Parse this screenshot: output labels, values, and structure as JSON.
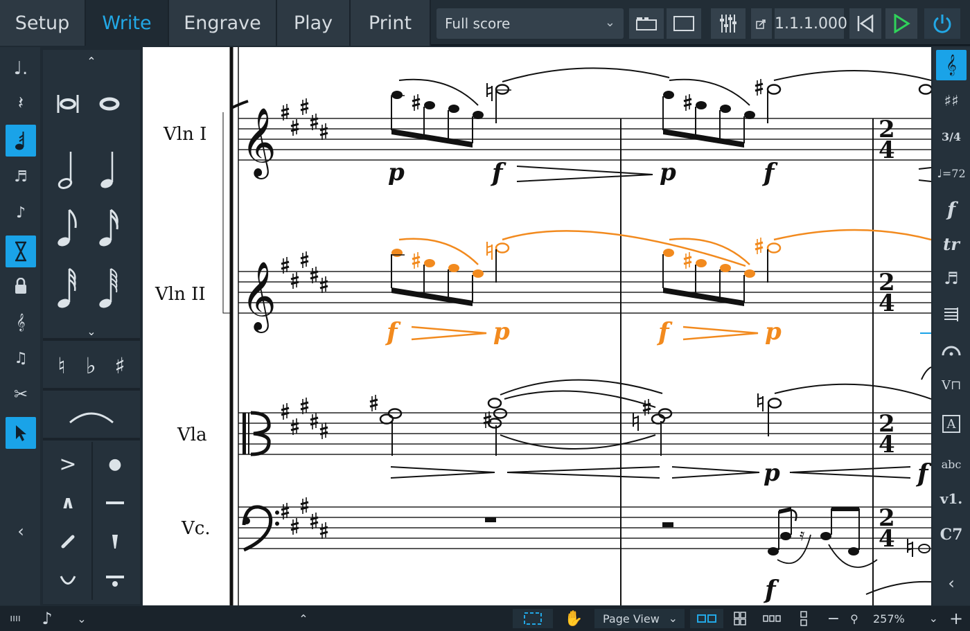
{
  "topbar": {
    "modes": [
      {
        "label": "Setup",
        "active": false
      },
      {
        "label": "Write",
        "active": true
      },
      {
        "label": "Engrave",
        "active": false
      },
      {
        "label": "Play",
        "active": false
      },
      {
        "label": "Print",
        "active": false
      }
    ],
    "layout_selector": "Full score",
    "position_readout": "1.1.1.000",
    "accent_color": "#22a8e6",
    "play_color": "#2fd25a",
    "buttons": [
      "galley-view-icon",
      "page-view-icon",
      "mixer-icon",
      "transport-rewind-icon",
      "play-icon",
      "power-icon"
    ]
  },
  "left_toolbox": {
    "items": [
      {
        "icon": "note-input-dotted-icon",
        "active": false
      },
      {
        "icon": "rest-icon",
        "active": false
      },
      {
        "icon": "note-input-mode-icon",
        "active": true
      },
      {
        "icon": "tuplet-icon",
        "active": false
      },
      {
        "icon": "grace-note-icon",
        "active": false
      },
      {
        "icon": "force-duration-icon",
        "active": true
      },
      {
        "icon": "lock-duration-icon",
        "active": false
      },
      {
        "icon": "chord-input-icon",
        "active": false
      },
      {
        "icon": "insert-mode-icon",
        "active": false
      },
      {
        "icon": "scissors-icon",
        "active": false
      },
      {
        "icon": "select-tool-icon",
        "active": true
      }
    ]
  },
  "notes_panel": {
    "durations": [
      "double-whole-note",
      "whole-note",
      "half-note",
      "quarter-note",
      "eighth-note",
      "sixteenth-note",
      "32nd-note",
      "64th-note"
    ],
    "accidentals": [
      "♮",
      "♭",
      "♯"
    ],
    "articulations": [
      "accent",
      "staccato",
      "marcato",
      "tenuto",
      "staccatissimo",
      "stress",
      "unstress",
      "tenuto-staccato"
    ]
  },
  "score": {
    "staves": [
      {
        "label": "Vln I",
        "clef": "treble"
      },
      {
        "label": "Vln II",
        "clef": "treble"
      },
      {
        "label": "Vla",
        "clef": "alto"
      },
      {
        "label": "Vc.",
        "clef": "bass"
      }
    ],
    "dynamics": {
      "piano": "p",
      "forte": "f"
    },
    "time_signature": {
      "top": "2",
      "bottom": "4"
    },
    "selection_color": "#f28a1e"
  },
  "right_panel": {
    "items": [
      {
        "icon": "clefs-icon",
        "active": true
      },
      {
        "icon": "key-signatures-icon",
        "active": false
      },
      {
        "icon": "time-signatures-icon",
        "label": "3/4",
        "active": false
      },
      {
        "icon": "tempo-icon",
        "label": "♩=72",
        "active": false
      },
      {
        "icon": "dynamics-icon",
        "label": "f",
        "active": false
      },
      {
        "icon": "ornaments-icon",
        "label": "tr",
        "active": false
      },
      {
        "icon": "repeat-icon",
        "active": false
      },
      {
        "icon": "bars-icon",
        "active": false
      },
      {
        "icon": "holds-pauses-icon",
        "active": false
      },
      {
        "icon": "playing-techniques-icon",
        "active": false
      },
      {
        "icon": "text-icon",
        "label": "A",
        "active": false
      },
      {
        "icon": "lyrics-icon",
        "label": "abc",
        "active": false
      },
      {
        "icon": "lyrics-verse-icon",
        "label": "v1.",
        "active": false
      },
      {
        "icon": "chord-symbols-icon",
        "label": "C7",
        "active": false
      }
    ]
  },
  "statusbar": {
    "view_type": "Page View",
    "zoom": "257%"
  }
}
